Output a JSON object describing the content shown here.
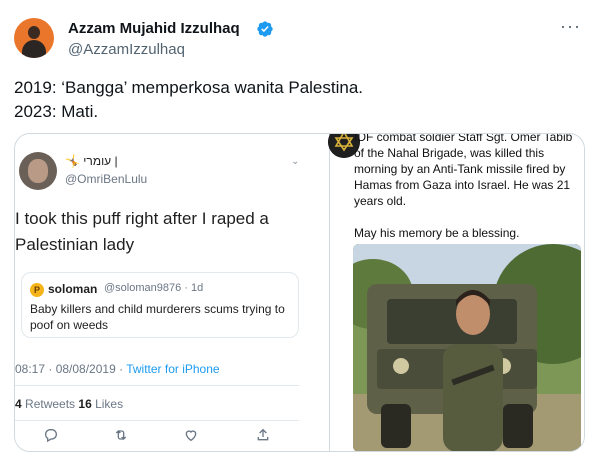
{
  "author": {
    "name": "Azzam Mujahid Izzulhaq",
    "handle": "@AzzamIzzulhaq"
  },
  "tweet": {
    "line1": "2019: ‘Bangga’ memperkosa wanita Palestina.",
    "line2": "2023: Mati."
  },
  "left_image": {
    "name": "עומרי |",
    "handle": "@OmriBenLulu",
    "text": "I took this puff right after I raped a Palestinian lady",
    "quote": {
      "icon": "P",
      "name": "soloman",
      "meta": "@soloman9876 · 1d",
      "text": "Baby killers and child murderers scums trying to poof on weeds"
    },
    "time": "08:17 · 08/08/2019 · ",
    "source": "Twitter for iPhone",
    "retweets": "4",
    "retweets_label": " Retweets  ",
    "likes": "16",
    "likes_label": " Likes"
  },
  "right_image": {
    "text": "IDF combat soldier Staff Sgt. Omer Tabib of the Nahal Brigade, was killed this morning by an Anti-Tank missile fired by Hamas from Gaza into Israel. He was 21 years old.",
    "blessing": "May his memory be a blessing."
  },
  "colors": {
    "accent": "#1d9bf0",
    "text": "#0f1419",
    "muted": "#536471",
    "border": "#cfd9de"
  }
}
